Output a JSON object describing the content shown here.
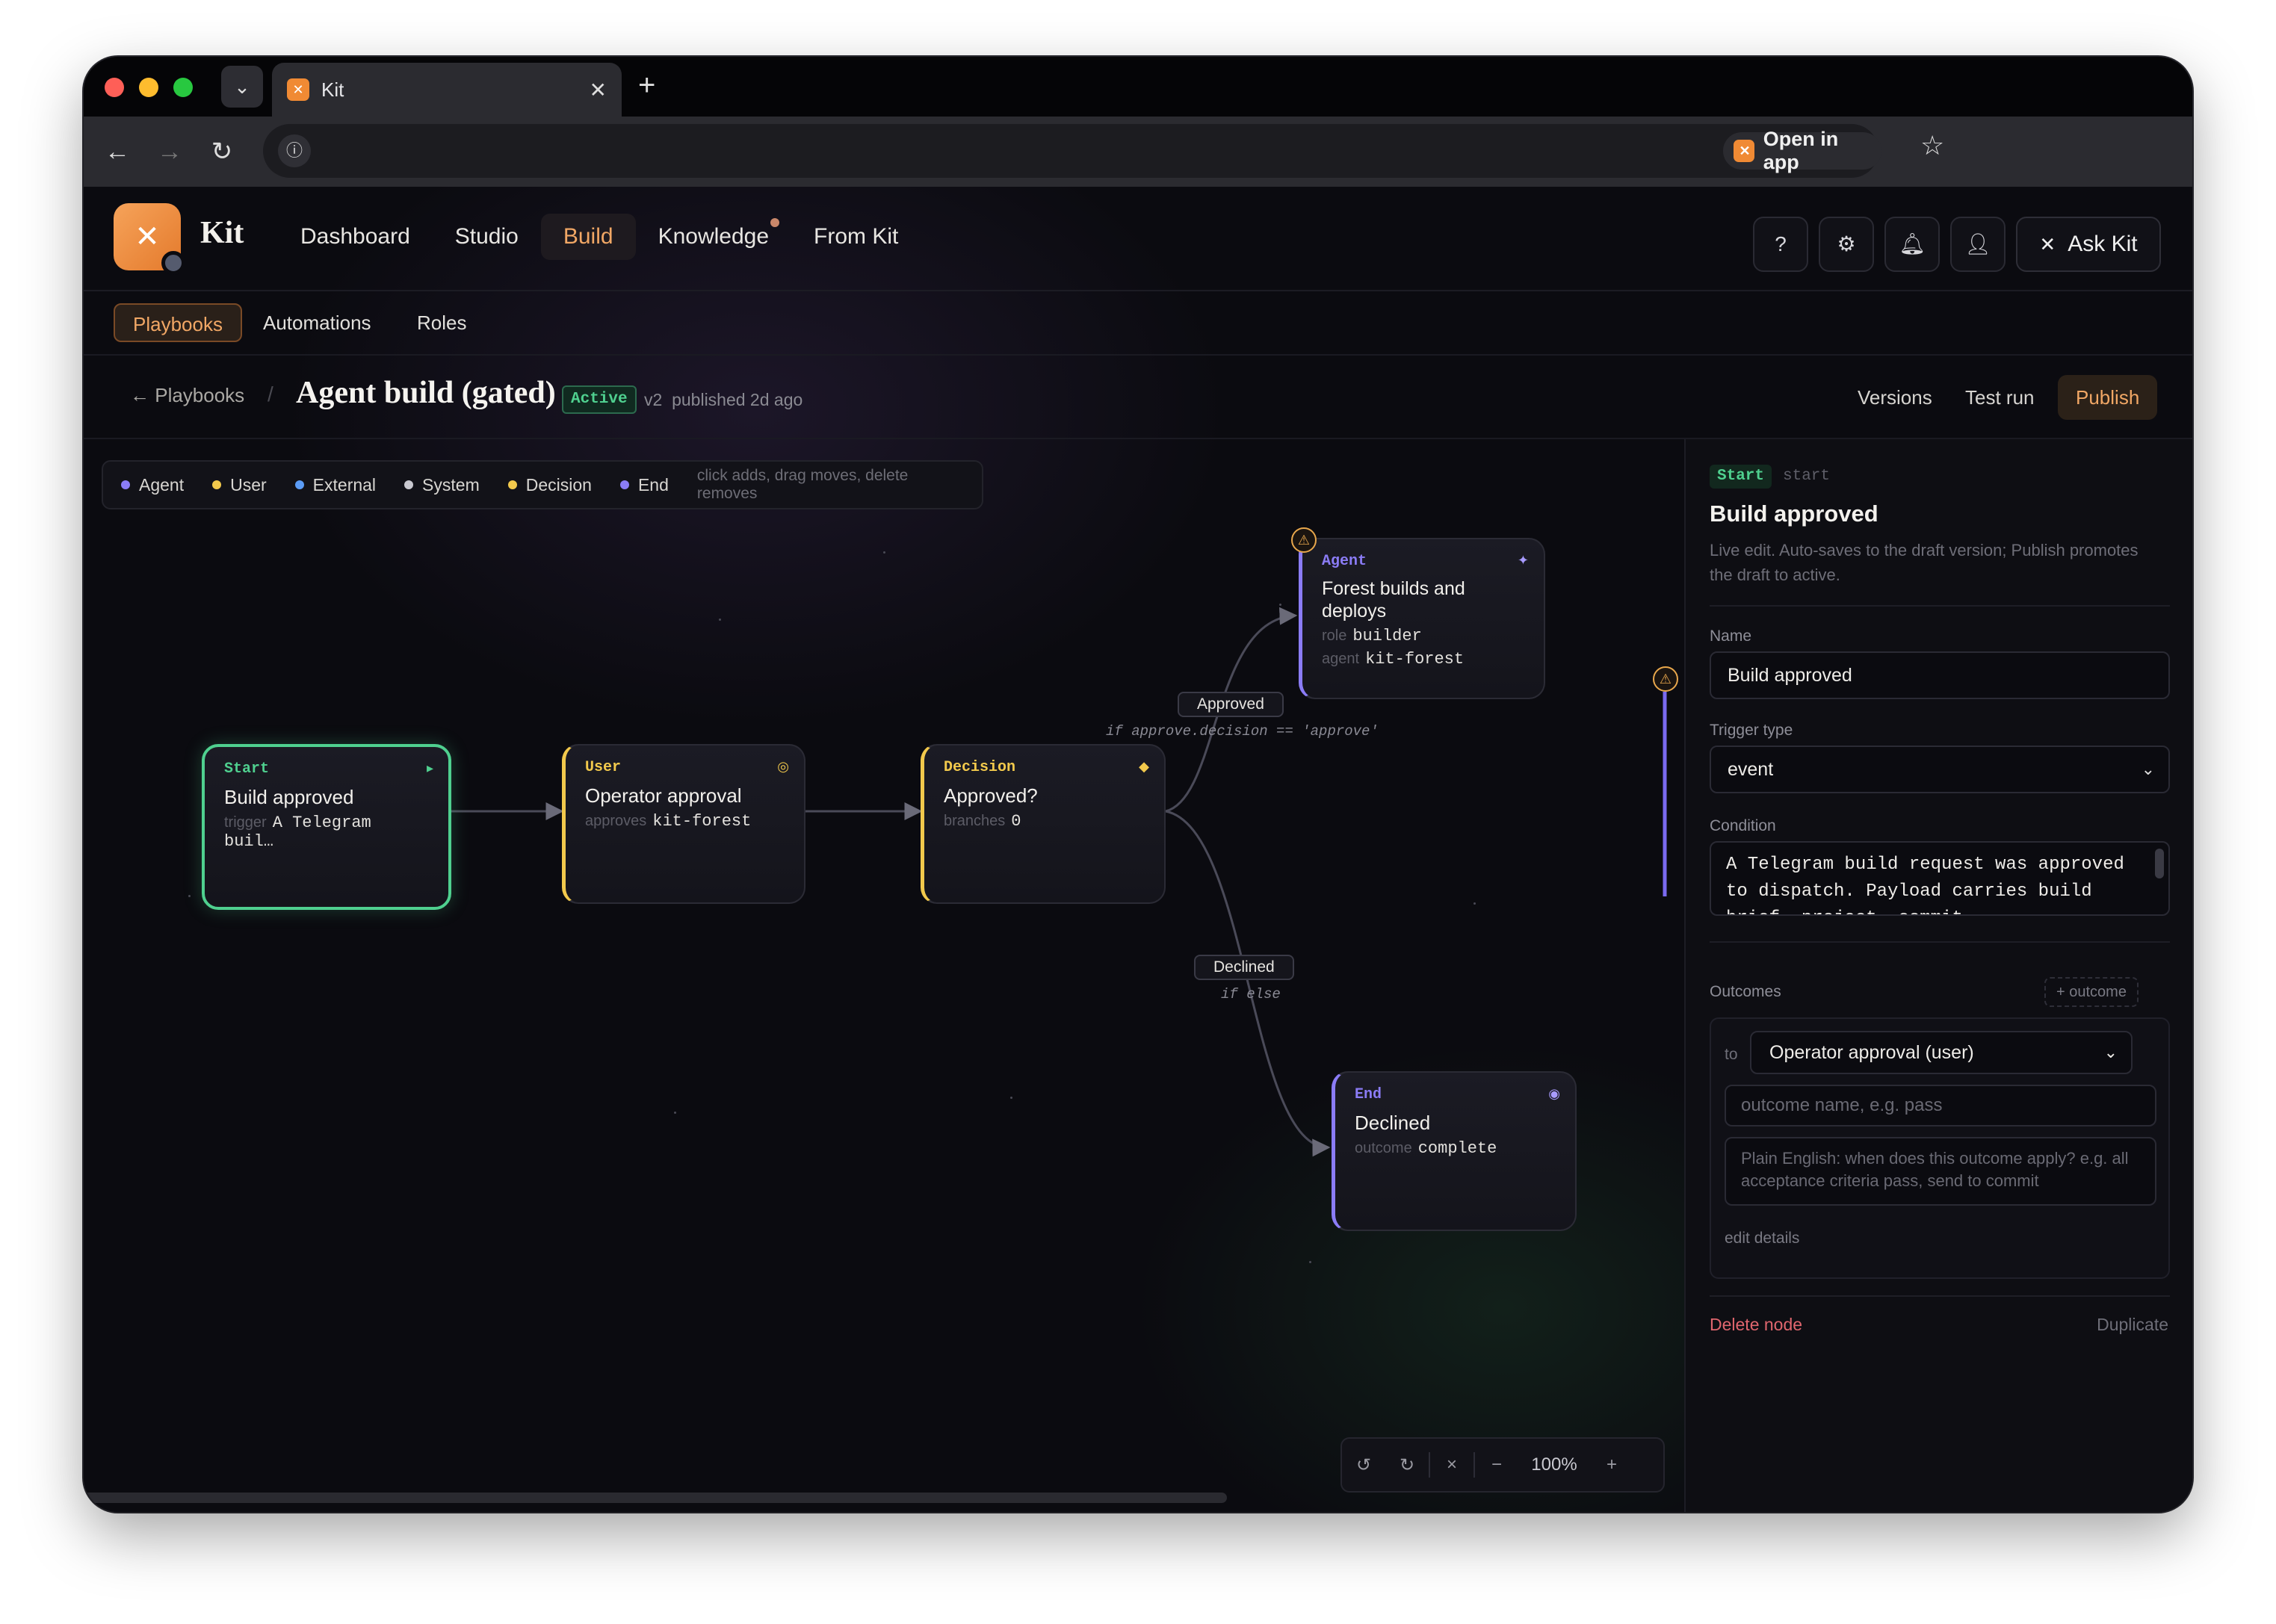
{
  "browser": {
    "tab_title": "Kit",
    "tab_close": "✕",
    "new_tab": "+",
    "open_in_app": "Open in app"
  },
  "app": {
    "brand": "Kit",
    "nav": [
      {
        "label": "Dashboard"
      },
      {
        "label": "Studio"
      },
      {
        "label": "Build"
      },
      {
        "label": "Knowledge"
      },
      {
        "label": "From Kit"
      }
    ],
    "ask_kit": "Ask Kit",
    "subnav": [
      {
        "label": "Playbooks"
      },
      {
        "label": "Automations"
      },
      {
        "label": "Roles"
      }
    ]
  },
  "crumb": {
    "back": "← Playbooks",
    "sep": "/",
    "title": "Agent build (gated)",
    "status": "Active",
    "version": "v2",
    "published": "published 2d ago",
    "actions": {
      "versions": "Versions",
      "test_run": "Test run",
      "publish": "Publish"
    }
  },
  "legend": {
    "items": [
      {
        "label": "Agent",
        "color": "#8b7cf6"
      },
      {
        "label": "User",
        "color": "#f2c94c"
      },
      {
        "label": "External",
        "color": "#5b9cf6"
      },
      {
        "label": "System",
        "color": "#c9c9d1"
      },
      {
        "label": "Decision",
        "color": "#f2c94c"
      },
      {
        "label": "End",
        "color": "#8b7cf6"
      }
    ],
    "hint": "click adds, drag moves, delete removes"
  },
  "nodes": {
    "start": {
      "type": "Start",
      "name": "Build approved",
      "meta_key": "trigger",
      "meta_val": "A Telegram buil…",
      "icon": "▸"
    },
    "user": {
      "type": "User",
      "name": "Operator approval",
      "meta_key": "approves",
      "meta_val": "kit-forest",
      "icon": "◎"
    },
    "decision": {
      "type": "Decision",
      "name": "Approved?",
      "meta_key": "branches",
      "meta_val": "0",
      "icon": "◆"
    },
    "agent": {
      "type": "Agent",
      "name": "Forest builds and deploys",
      "role_key": "role",
      "role_val": "builder",
      "agent_key": "agent",
      "agent_val": "kit-forest",
      "icon": "✦"
    },
    "end": {
      "type": "End",
      "name": "Declined",
      "meta_key": "outcome",
      "meta_val": "complete",
      "icon": "◉"
    }
  },
  "edges": {
    "approved": {
      "label": "Approved",
      "condition": "if approve.decision == 'approve'"
    },
    "declined": {
      "label": "Declined",
      "condition": "if else"
    }
  },
  "zoom": {
    "undo": "↺",
    "redo": "↻",
    "fit": "×",
    "minus": "−",
    "level": "100%",
    "plus": "+"
  },
  "panel": {
    "badge": "Start",
    "key": "start",
    "title": "Build approved",
    "desc": "Live edit. Auto-saves to the draft version; Publish promotes the draft to active.",
    "name_label": "Name",
    "name_value": "Build approved",
    "trigger_label": "Trigger type",
    "trigger_value": "event",
    "condition_label": "Condition",
    "condition_value": "A Telegram build request was approved to dispatch. Payload carries build brief, project, commit",
    "outcomes_label": "Outcomes",
    "add_outcome": "+ outcome",
    "outcome_to": "to",
    "outcome_target": "Operator approval (user)",
    "outcome_name_placeholder": "outcome name, e.g. pass",
    "outcome_when_placeholder": "Plain English: when does this outcome apply? e.g. all acceptance criteria pass, send to commit",
    "edit_details": "edit details",
    "delete_node": "Delete node",
    "duplicate": "Duplicate"
  },
  "colors": {
    "accent": "#f1a765",
    "start": "#4fd08f",
    "user": "#f2c94c",
    "agent": "#8b7cf6"
  }
}
